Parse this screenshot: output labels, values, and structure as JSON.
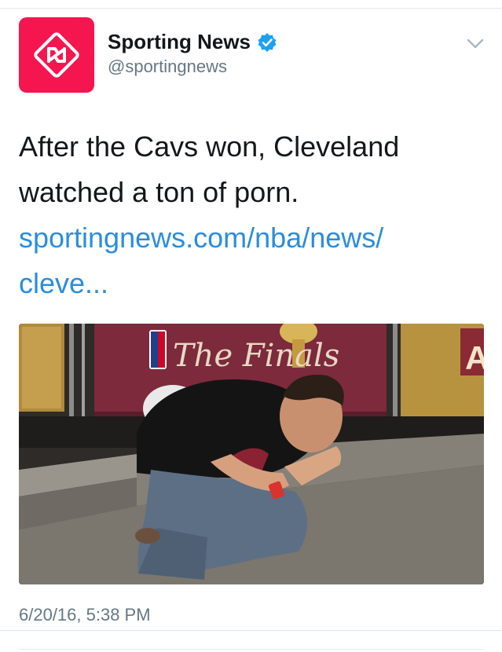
{
  "tweet": {
    "author": {
      "display_name": "Sporting News",
      "handle": "@sportingnews",
      "verified": true,
      "avatar_icon": "sporting-news-logo-icon",
      "avatar_color": "#f5164f"
    },
    "text_line_1": "After the Cavs won, Cleveland",
    "text_line_2": "watched a ton of porn.",
    "link_line_1": "sportingnews.com/nba/news/",
    "link_line_2": "cleve...",
    "link_color": "#2b8ddb",
    "media": {
      "banner_text": "The Finals",
      "side_sign_letter": "A"
    },
    "timestamp": "6/20/16, 5:38 PM",
    "menu_icon": "chevron-down-icon",
    "verified_color": "#1da1f2"
  }
}
